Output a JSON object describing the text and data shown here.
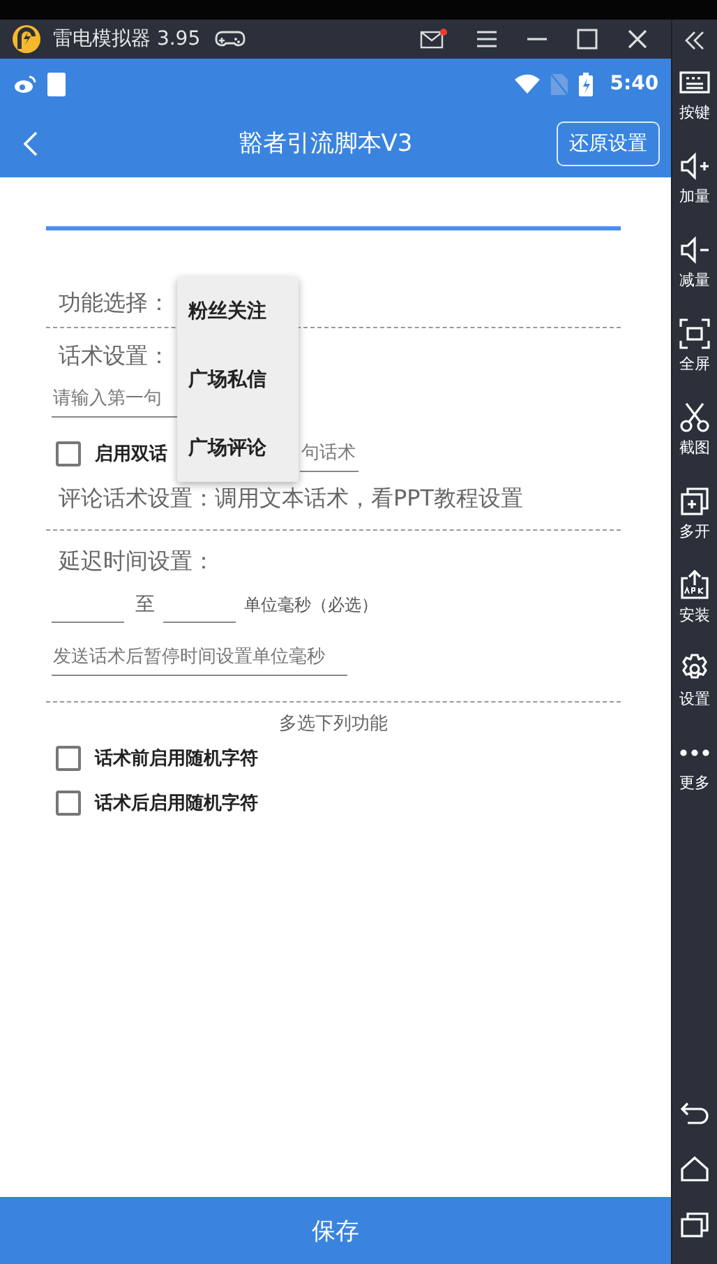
{
  "emulator": {
    "title": "雷电模拟器 3.95",
    "mail_unread": true
  },
  "status_bar": {
    "time": "5:40"
  },
  "app_bar": {
    "title": "豁者引流脚本V3",
    "reset_button": "还原设置"
  },
  "form": {
    "function_label": "功能选择：",
    "script_label": "话术设置：",
    "first_script_placeholder": "请输入第一句",
    "dual_script": {
      "label": "启用双话",
      "checked": false
    },
    "second_script_placeholder": "句话术",
    "comment_note": "评论话术设置：调用文本话术，看PPT教程设置",
    "delay_label": "延迟时间设置：",
    "delay_to": "至",
    "delay_unit": "单位毫秒（必选）",
    "pause_placeholder": "发送话术后暂停时间设置单位毫秒",
    "multi_title": "多选下列功能",
    "options": [
      {
        "label": "话术前启用随机字符",
        "checked": false
      },
      {
        "label": "话术后启用随机字符",
        "checked": false
      }
    ]
  },
  "dropdown": {
    "options": [
      {
        "label": "粉丝关注"
      },
      {
        "label": "广场私信"
      },
      {
        "label": "广场评论"
      }
    ]
  },
  "side_toolbar": [
    {
      "label": "按键"
    },
    {
      "label": "加量"
    },
    {
      "label": "减量"
    },
    {
      "label": "全屏"
    },
    {
      "label": "截图"
    },
    {
      "label": "多开"
    },
    {
      "label": "安装"
    },
    {
      "label": "设置"
    },
    {
      "label": "更多"
    }
  ],
  "save_button": "保存"
}
